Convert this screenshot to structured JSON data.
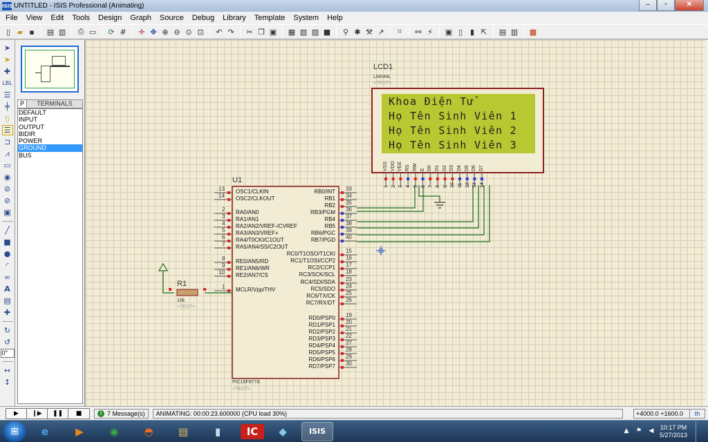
{
  "window": {
    "title": "UNTITLED - ISIS Professional (Animating)",
    "app_icon": "ISIS",
    "controls": [
      "–",
      "▫",
      "✕"
    ]
  },
  "menu": [
    "File",
    "View",
    "Edit",
    "Tools",
    "Design",
    "Graph",
    "Source",
    "Debug",
    "Library",
    "Template",
    "System",
    "Help"
  ],
  "panel": {
    "mode_letter": "P",
    "title": "TERMINALS",
    "items": [
      "DEFAULT",
      "INPUT",
      "OUTPUT",
      "BIDIR",
      "POWER",
      "GROUND",
      "BUS"
    ],
    "selected": "GROUND"
  },
  "left_tools": {
    "rotation_angle": "0°"
  },
  "schematic": {
    "lcd": {
      "ref": "LCD1",
      "part": "LM044L",
      "text_tag": "<TEXT>",
      "screen_color": "#b8c832",
      "lines": [
        "Khoa Điện Tử",
        "Họ Tên Sinh Viên 1",
        "Họ Tên Sinh Viên 2",
        "Họ Tên Sinh Viên 3"
      ],
      "pin_labels": [
        "VSS",
        "VDD",
        "VEE",
        "RS",
        "RW",
        "E",
        "D0",
        "D1",
        "D2",
        "D3",
        "D4",
        "D5",
        "D6",
        "D7"
      ],
      "pin_numbers": [
        "1",
        "2",
        "3",
        "4",
        "5",
        "6",
        "7",
        "8",
        "9",
        "10",
        "11",
        "12",
        "13",
        "14"
      ]
    },
    "mcu": {
      "ref": "U1",
      "part": "PIC16F877A",
      "text_tag": "<TEXT>",
      "left_pins": [
        {
          "num": "13",
          "name": "OSC1/CLKIN"
        },
        {
          "num": "14",
          "name": "OSC2/CLKOUT"
        },
        {
          "num": "2",
          "name": "RA0/AN0"
        },
        {
          "num": "3",
          "name": "RA1/AN1"
        },
        {
          "num": "4",
          "name": "RA2/AN2/VREF-/CVREF"
        },
        {
          "num": "5",
          "name": "RA3/AN3/VREF+"
        },
        {
          "num": "6",
          "name": "RA4/T0CKI/C1OUT"
        },
        {
          "num": "7",
          "name": "RA5/AN4/SS/C2OUT"
        },
        {
          "num": "8",
          "name": "RE0/AN5/RD"
        },
        {
          "num": "9",
          "name": "RE1/AN6/WR"
        },
        {
          "num": "10",
          "name": "RE2/AN7/CS"
        },
        {
          "num": "1",
          "name": "MCLR/Vpp/THV"
        }
      ],
      "right_pins": [
        {
          "num": "33",
          "name": "RB0/INT"
        },
        {
          "num": "34",
          "name": "RB1"
        },
        {
          "num": "35",
          "name": "RB2"
        },
        {
          "num": "36",
          "name": "RB3/PGM"
        },
        {
          "num": "37",
          "name": "RB4"
        },
        {
          "num": "38",
          "name": "RB5"
        },
        {
          "num": "39",
          "name": "RB6/PGC"
        },
        {
          "num": "40",
          "name": "RB7/PGD"
        },
        {
          "num": "15",
          "name": "RC0/T1OSO/T1CKI"
        },
        {
          "num": "16",
          "name": "RC1/T1OSI/CCP2"
        },
        {
          "num": "17",
          "name": "RC2/CCP1"
        },
        {
          "num": "18",
          "name": "RC3/SCK/SCL"
        },
        {
          "num": "23",
          "name": "RC4/SDI/SDA"
        },
        {
          "num": "24",
          "name": "RC5/SDO"
        },
        {
          "num": "25",
          "name": "RC6/TX/CK"
        },
        {
          "num": "26",
          "name": "RC7/RX/DT"
        },
        {
          "num": "19",
          "name": "RD0/PSP0"
        },
        {
          "num": "20",
          "name": "RD1/PSP1"
        },
        {
          "num": "21",
          "name": "RD2/PSP2"
        },
        {
          "num": "22",
          "name": "RD3/PSP3"
        },
        {
          "num": "27",
          "name": "RD4/PSP4"
        },
        {
          "num": "28",
          "name": "RD5/PSP5"
        },
        {
          "num": "29",
          "name": "RD6/PSP6"
        },
        {
          "num": "30",
          "name": "RD7/PSP7"
        }
      ]
    },
    "resistor": {
      "ref": "R1",
      "value": "10k",
      "text_tag": "<TEXT>"
    }
  },
  "status": {
    "sim_buttons": [
      "▶",
      "❙▶",
      "❚❚",
      "■"
    ],
    "messages": "7 Message(s)",
    "animating": "ANIMATING: 00:00:23.600000 (CPU load 30%)",
    "coords": "+4000.0  +1600.0",
    "units": "th"
  },
  "taskbar": {
    "apps": [
      "e",
      "▶",
      "◉",
      "◓",
      "▤",
      "▮",
      "IC",
      "◆",
      "ISIS"
    ],
    "time": "10:17 PM",
    "date": "5/27/2013"
  }
}
